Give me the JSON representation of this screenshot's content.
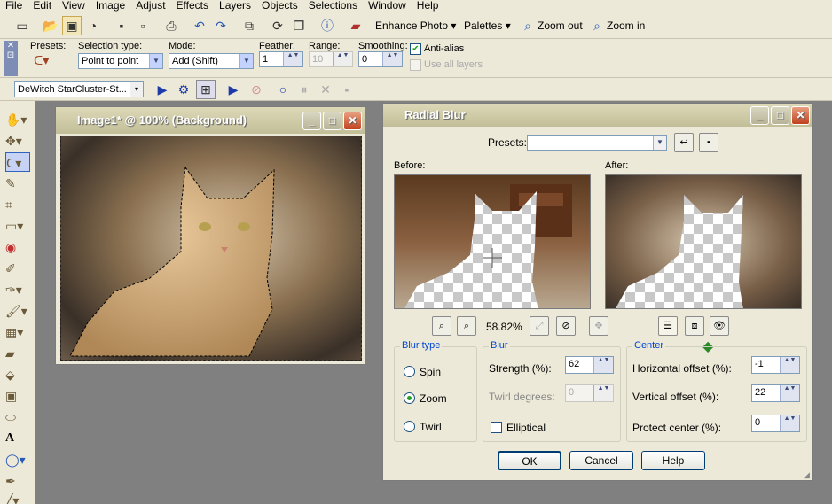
{
  "menu": [
    "File",
    "Edit",
    "View",
    "Image",
    "Adjust",
    "Effects",
    "Layers",
    "Objects",
    "Selections",
    "Window",
    "Help"
  ],
  "toolbar": {
    "enhance_photo": "Enhance Photo",
    "palettes": "Palettes",
    "zoom_out": "Zoom out",
    "zoom_in": "Zoom in"
  },
  "options": {
    "presets_label": "Presets:",
    "selection_type_label": "Selection type:",
    "selection_type_value": "Point to point",
    "mode_label": "Mode:",
    "mode_value": "Add (Shift)",
    "feather_label": "Feather:",
    "feather_value": "1",
    "range_label": "Range:",
    "range_value": "10",
    "smoothing_label": "Smoothing:",
    "smoothing_value": "0",
    "antialias_label": "Anti-alias",
    "use_all_layers_label": "Use all layers"
  },
  "script": {
    "name": "DeWitch StarCluster-St..."
  },
  "image_window": {
    "title": "Image1* @ 100% (Background)"
  },
  "dialog": {
    "title": "Radial Blur",
    "presets_label": "Presets:",
    "before_label": "Before:",
    "after_label": "After:",
    "zoom_value": "58.82%",
    "blur_type_title": "Blur type",
    "spin": "Spin",
    "zoom": "Zoom",
    "twirl": "Twirl",
    "blur_title": "Blur",
    "strength_label": "Strength (%):",
    "strength_value": "62",
    "twirl_label": "Twirl degrees:",
    "twirl_value": "0",
    "elliptical_label": "Elliptical",
    "center_title": "Center",
    "h_offset_label": "Horizontal offset (%):",
    "h_offset_value": "-1",
    "v_offset_label": "Vertical offset (%):",
    "v_offset_value": "22",
    "protect_label": "Protect center (%):",
    "protect_value": "0",
    "ok": "OK",
    "cancel": "Cancel",
    "help": "Help"
  }
}
